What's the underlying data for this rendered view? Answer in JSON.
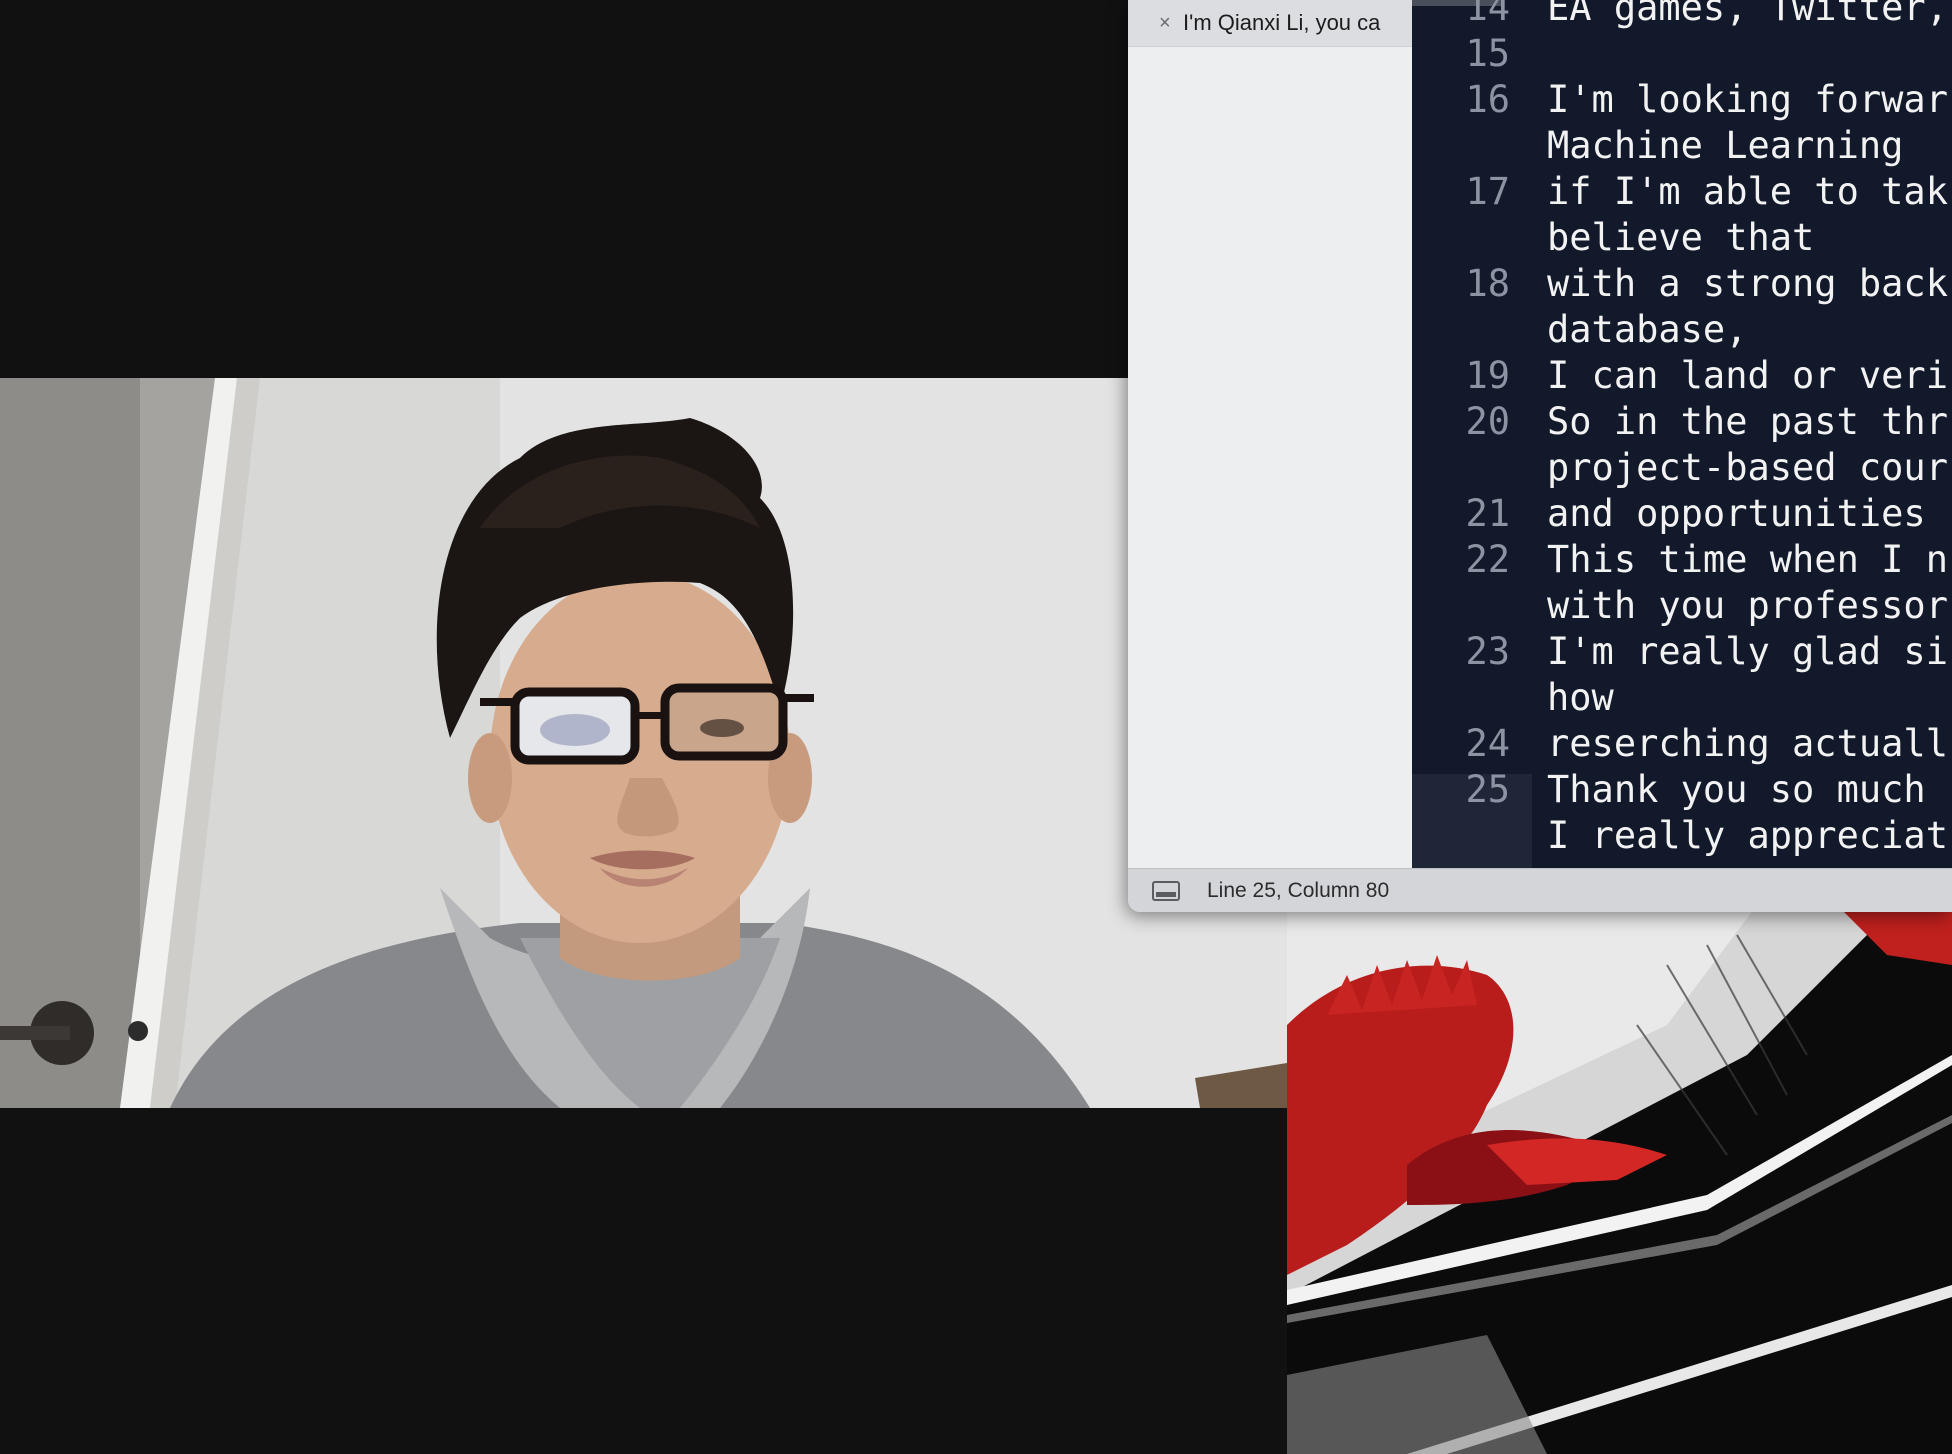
{
  "editor": {
    "tab_title": "I'm Qianxi Li, you ca",
    "close_glyph": "×",
    "status": "Line 25, Column 80",
    "lines": [
      {
        "num": "14",
        "text": "EA games, Twitter,"
      },
      {
        "num": "15",
        "text": ""
      },
      {
        "num": "16",
        "text": "I'm looking forwar",
        "cont": "Machine Learning"
      },
      {
        "num": "17",
        "text": "if I'm able to tak",
        "cont": "believe that"
      },
      {
        "num": "18",
        "text": "with a strong back",
        "cont": "database,"
      },
      {
        "num": "19",
        "text": "I can land or veri"
      },
      {
        "num": "20",
        "text": "So in the past thr",
        "cont": "project-based cour"
      },
      {
        "num": "21",
        "text": "and opportunities"
      },
      {
        "num": "22",
        "text": "This time when I n",
        "cont": "with you professor"
      },
      {
        "num": "23",
        "text": "I'm really glad si",
        "cont": "how"
      },
      {
        "num": "24",
        "text": "reserching actuall"
      },
      {
        "num": "25",
        "text": "Thank you so much",
        "cont": "I really appreciat"
      }
    ],
    "current_line": "25"
  },
  "colors": {
    "screen_background": "#111111",
    "code_background": "#11192a",
    "sidebar_background": "#edeeef",
    "wallpaper_red": "#c0201e"
  }
}
